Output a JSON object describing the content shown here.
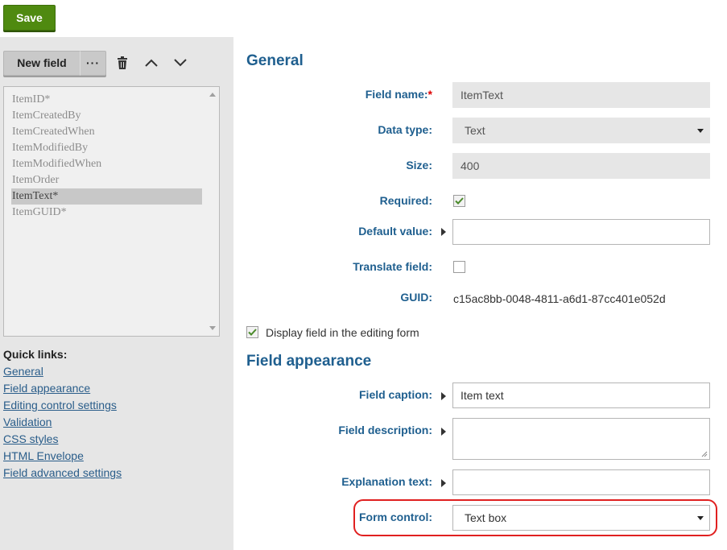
{
  "toolbar": {
    "save_label": "Save",
    "new_field_label": "New field",
    "more_label": "···"
  },
  "field_list": {
    "items": [
      "ItemID*",
      "ItemCreatedBy",
      "ItemCreatedWhen",
      "ItemModifiedBy",
      "ItemModifiedWhen",
      "ItemOrder",
      "ItemText*",
      "ItemGUID*"
    ],
    "selected": "ItemText*"
  },
  "quick_links": {
    "title": "Quick links:",
    "links": [
      "General",
      "Field appearance",
      "Editing control settings",
      "Validation",
      "CSS styles",
      "HTML Envelope",
      "Field advanced settings"
    ]
  },
  "general": {
    "title": "General",
    "field_name_label": "Field name:",
    "field_name_required_mark": "*",
    "field_name_value": "ItemText",
    "data_type_label": "Data type:",
    "data_type_value": "Text",
    "size_label": "Size:",
    "size_value": "400",
    "required_label": "Required:",
    "required_checked": true,
    "default_value_label": "Default value:",
    "default_value": "",
    "translate_label": "Translate field:",
    "translate_checked": false,
    "guid_label": "GUID:",
    "guid_value": "c15ac8bb-0048-4811-a6d1-87cc401e052d",
    "display_field_label": "Display field in the editing form",
    "display_field_checked": true
  },
  "appearance": {
    "title": "Field appearance",
    "caption_label": "Field caption:",
    "caption_value": "Item text",
    "description_label": "Field description:",
    "description_value": "",
    "explanation_label": "Explanation text:",
    "explanation_value": "",
    "form_control_label": "Form control:",
    "form_control_value": "Text box"
  },
  "colors": {
    "accent": "#1f5f8f",
    "save_button": "#4f8a10",
    "highlight": "#e02020"
  }
}
